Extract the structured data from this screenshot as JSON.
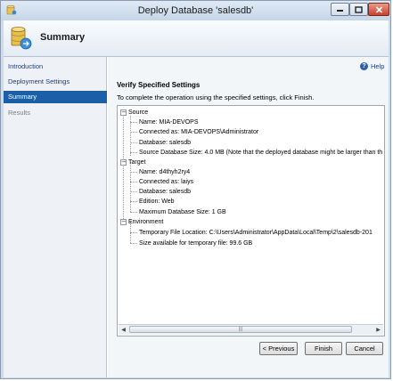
{
  "window": {
    "title": "Deploy Database 'salesdb'"
  },
  "header": {
    "title": "Summary"
  },
  "nav": {
    "items": [
      {
        "label": "Introduction",
        "state": "link"
      },
      {
        "label": "Deployment Settings",
        "state": "link"
      },
      {
        "label": "Summary",
        "state": "selected"
      },
      {
        "label": "Results",
        "state": "disabled"
      }
    ]
  },
  "main": {
    "help_label": "Help",
    "section_title": "Verify Specified Settings",
    "instruction": "To complete the operation using the specified settings, click Finish.",
    "tree": {
      "source": {
        "label": "Source",
        "items": [
          "Name: MIA-DEVOPS",
          "Connected as: MIA-DEVOPS\\Administrator",
          "Database: salesdb",
          "Source Database Size: 4.0 MB (Note that the deployed database might be larger than th"
        ]
      },
      "target": {
        "label": "Target",
        "items": [
          "Name: d4thyh2ry4",
          "Connected as: laiys",
          "Database: salesdb",
          "Edition: Web",
          "Maximum Database Size: 1 GB"
        ]
      },
      "environment": {
        "label": "Environment",
        "items": [
          "Temporary File Location: C:\\Users\\Administrator\\AppData\\Local\\Temp\\2\\salesdb-201",
          "Size available for temporary file: 99.6 GB"
        ]
      },
      "collapse_glyph": "−"
    }
  },
  "footer": {
    "previous": "< Previous",
    "finish": "Finish",
    "cancel": "Cancel"
  },
  "colors": {
    "nav_selected": "#1b5fa8",
    "link": "#1e3a8a",
    "close_button": "#c9402a"
  }
}
